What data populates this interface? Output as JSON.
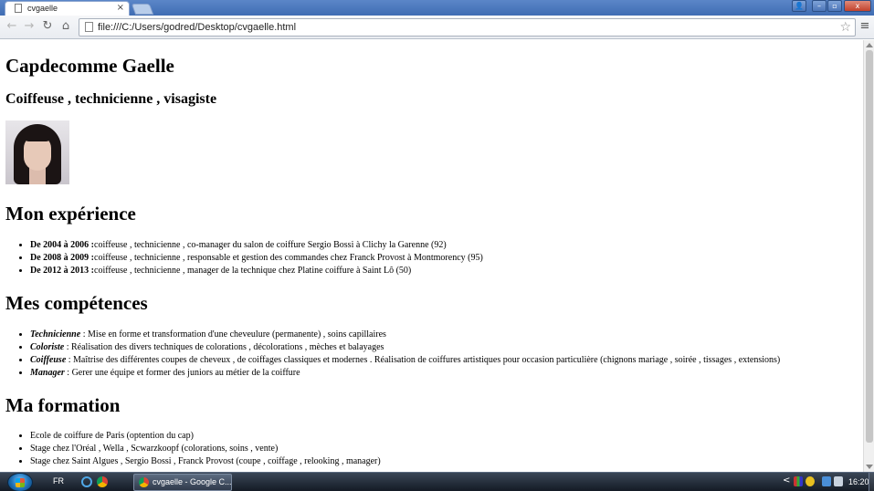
{
  "browser": {
    "tab_title": "cvgaelle",
    "tab_close_glyph": "×",
    "url": "file:///C:/Users/godred/Desktop/cvgaelle.html",
    "window_buttons": {
      "user": "👤",
      "minimize": "–",
      "maximize": "▫",
      "close": "x"
    }
  },
  "page": {
    "name": "Capdecomme Gaelle",
    "subtitle": "Coiffeuse , technicienne , visagiste",
    "experience": {
      "title": "Mon expérience",
      "items": [
        {
          "period": "De 2004 à 2006 :",
          "text": "coiffeuse , technicienne , co-manager du salon de coiffure Sergio Bossi à Clichy la Garenne (92)"
        },
        {
          "period": "De 2008 à 2009 :",
          "text": "coiffeuse , technicienne , responsable et gestion des commandes chez Franck Provost à Montmorency (95)"
        },
        {
          "period": "De 2012 à 2013 :",
          "text": "coiffeuse , technicienne , manager de la technique chez Platine coiffure à Saint Lô (50)"
        }
      ]
    },
    "skills": {
      "title": "Mes compétences",
      "items": [
        {
          "name": "Technicienne",
          "text": " : Mise en forme et transformation d'une cheveulure (permanente) , soins capillaires"
        },
        {
          "name": "Coloriste",
          "text": " : Réalisation des divers techniques de colorations , décolorations , mèches et balayages"
        },
        {
          "name": "Coiffeuse",
          "text": " : Maîtrise des différentes coupes de cheveux , de coiffages classiques et modernes . Réalisation de coiffures artistiques pour occasion particulière (chignons mariage , soirée , tissages , extensions)"
        },
        {
          "name": "Manager",
          "text": " : Gerer une équipe et former des juniors au métier de la coiffure"
        }
      ]
    },
    "education": {
      "title": "Ma formation",
      "items": [
        "Ecole de coiffure de Paris (optention du cap)",
        "Stage chez l'Oréal , Wella , Scwarzkoopf (colorations, soins , vente)",
        "Stage chez Saint Algues , Sergio Bossi , Franck Provost (coupe , coiffage , relooking , manager)"
      ]
    }
  },
  "taskbar": {
    "language": "FR",
    "task_label": "cvgaelle - Google C...",
    "tray_chevron": "<",
    "clock": "16:20"
  },
  "icons": {
    "nav_back": "←",
    "nav_forward": "→",
    "reload": "↻",
    "home": "⌂",
    "star": "☆",
    "menu": "≡"
  }
}
